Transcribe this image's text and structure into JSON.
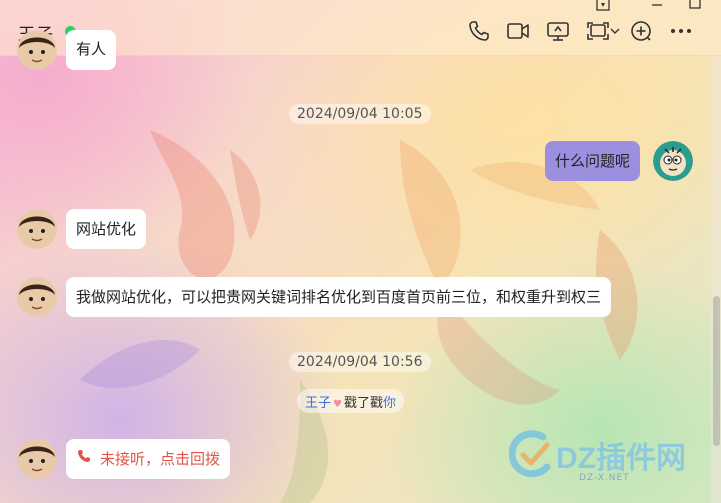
{
  "header": {
    "title": "王子",
    "status_color": "#2bd26b",
    "icons": [
      "phone-icon",
      "video-call-icon",
      "screen-share-icon",
      "remote-assist-icon",
      "chevron-down-icon",
      "add-member-icon",
      "more-icon"
    ]
  },
  "messages": {
    "top_partial": "有人",
    "time1": "2024/09/04 10:05",
    "msg_self_1": "什么问题呢",
    "msg_1": "网站优化",
    "msg_2": "我做网站优化，可以把贵网关键词排名优化到百度首页前三位，和权重升到权三",
    "time2": "2024/09/04 10:56",
    "poke": {
      "name": "王子",
      "text": "戳了戳",
      "target": "你"
    },
    "call": "未接听，点击回拨"
  },
  "colors": {
    "self_bubble": "#9b8fe0",
    "incoming_bubble": "#ffffff",
    "missed_call": "#e05545"
  },
  "watermark": {
    "brand": "DZ插件网",
    "url": "DZ-X.NET"
  }
}
